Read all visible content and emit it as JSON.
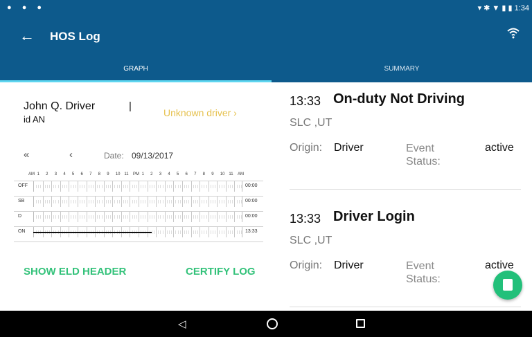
{
  "status_bar": {
    "left_icons": [
      "location-icon",
      "shield-icon",
      "android-icon"
    ],
    "time": "1:34"
  },
  "app_bar": {
    "title": "HOS Log"
  },
  "tabs": [
    {
      "label": "GRAPH",
      "selected": true
    },
    {
      "label": "SUMMARY",
      "selected": false
    }
  ],
  "driver": {
    "name": "John Q. Driver",
    "id": "id AN",
    "separator": "|",
    "unknown_link": "Unknown driver  ›"
  },
  "date_nav": {
    "first": "«",
    "prev": "‹",
    "date_label": "Date:",
    "date_value": "09/13/2017"
  },
  "graph": {
    "hour_labels": [
      "AM",
      "1",
      "2",
      "3",
      "4",
      "5",
      "6",
      "7",
      "8",
      "9",
      "10",
      "11",
      "PM",
      "1",
      "2",
      "3",
      "4",
      "5",
      "6",
      "7",
      "8",
      "9",
      "10",
      "11",
      "AM"
    ],
    "rows": [
      {
        "label": "OFF",
        "total": "00:00"
      },
      {
        "label": "SB",
        "total": "00:00"
      },
      {
        "label": "D",
        "total": "00:00"
      },
      {
        "label": "ON",
        "total": "13:33"
      }
    ],
    "on_duty_end_hour": 13.55
  },
  "actions": {
    "eld_header": "SHOW ELD HEADER",
    "certify": "CERTIFY LOG"
  },
  "events": [
    {
      "time": "13:33",
      "title": "On-duty Not Driving",
      "location": "SLC ,UT",
      "origin_label": "Origin:",
      "origin": "Driver",
      "status_label": "Event Status:",
      "status": "active"
    },
    {
      "time": "13:33",
      "title": "Driver Login",
      "location": "SLC ,UT",
      "origin_label": "Origin:",
      "origin": "Driver",
      "status_label": "Event Status:",
      "status": "active"
    }
  ],
  "colors": {
    "primary": "#0d5a8c",
    "accent": "#33c27a",
    "warning": "#e6c14e",
    "tab_indicator": "#5fd6f0"
  }
}
